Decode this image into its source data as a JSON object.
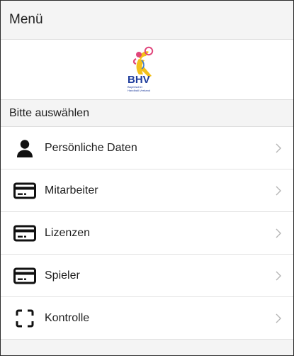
{
  "header": {
    "title": "Menü"
  },
  "logo": {
    "text": "BHV",
    "subtext_line1": "Bayerischer",
    "subtext_line2": "Handball-Verband"
  },
  "section": {
    "title": "Bitte auswählen"
  },
  "menu": {
    "items": [
      {
        "label": "Persönliche Daten",
        "icon": "person-icon"
      },
      {
        "label": "Mitarbeiter",
        "icon": "card-icon"
      },
      {
        "label": "Lizenzen",
        "icon": "card-icon"
      },
      {
        "label": "Spieler",
        "icon": "card-icon"
      },
      {
        "label": "Kontrolle",
        "icon": "scan-frame-icon"
      }
    ]
  },
  "colors": {
    "header_bg": "#f4f4f4",
    "divider": "#dddddd",
    "icon": "#111111",
    "chevron": "#b5b5b5",
    "logo_blue": "#1f3d9c",
    "logo_yellow": "#f3c01a",
    "logo_pink": "#e0457b"
  }
}
